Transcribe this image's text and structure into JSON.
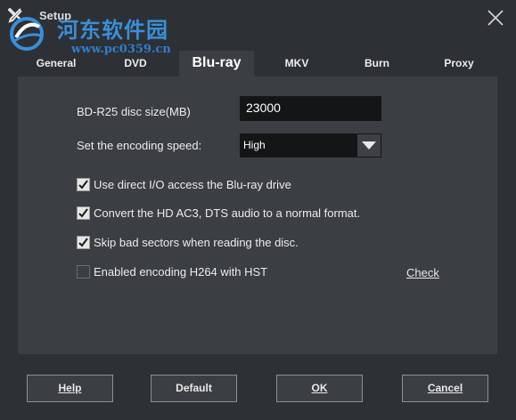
{
  "window": {
    "title": "Setup",
    "close_icon": "close-icon",
    "app_icon": "tools-icon"
  },
  "watermark": {
    "name": "河东软件园",
    "url": "www.pc0359.cn"
  },
  "tabs": [
    {
      "label": "General"
    },
    {
      "label": "DVD"
    },
    {
      "label": "Blu-ray",
      "active": true
    },
    {
      "label": "MKV"
    },
    {
      "label": "Burn"
    },
    {
      "label": "Proxy"
    }
  ],
  "bluray": {
    "disc_size_label": "BD-R25 disc size(MB)",
    "disc_size_value": "23000",
    "speed_label": "Set the encoding speed:",
    "speed_value": "High",
    "options": [
      {
        "label": "Use direct I/O access the Blu-ray drive",
        "checked": true
      },
      {
        "label": "Convert the HD AC3, DTS audio to a normal format.",
        "checked": true
      },
      {
        "label": "Skip bad sectors when reading the disc.",
        "checked": true
      },
      {
        "label": "Enabled encoding H264 with HST",
        "checked": false
      }
    ],
    "check_link": "Check"
  },
  "buttons": {
    "help": "Help",
    "default": "Default",
    "ok": "OK",
    "cancel": "Cancel"
  },
  "colors": {
    "background": "#2d3034",
    "panel": "#3b3e42",
    "field": "#141516"
  }
}
